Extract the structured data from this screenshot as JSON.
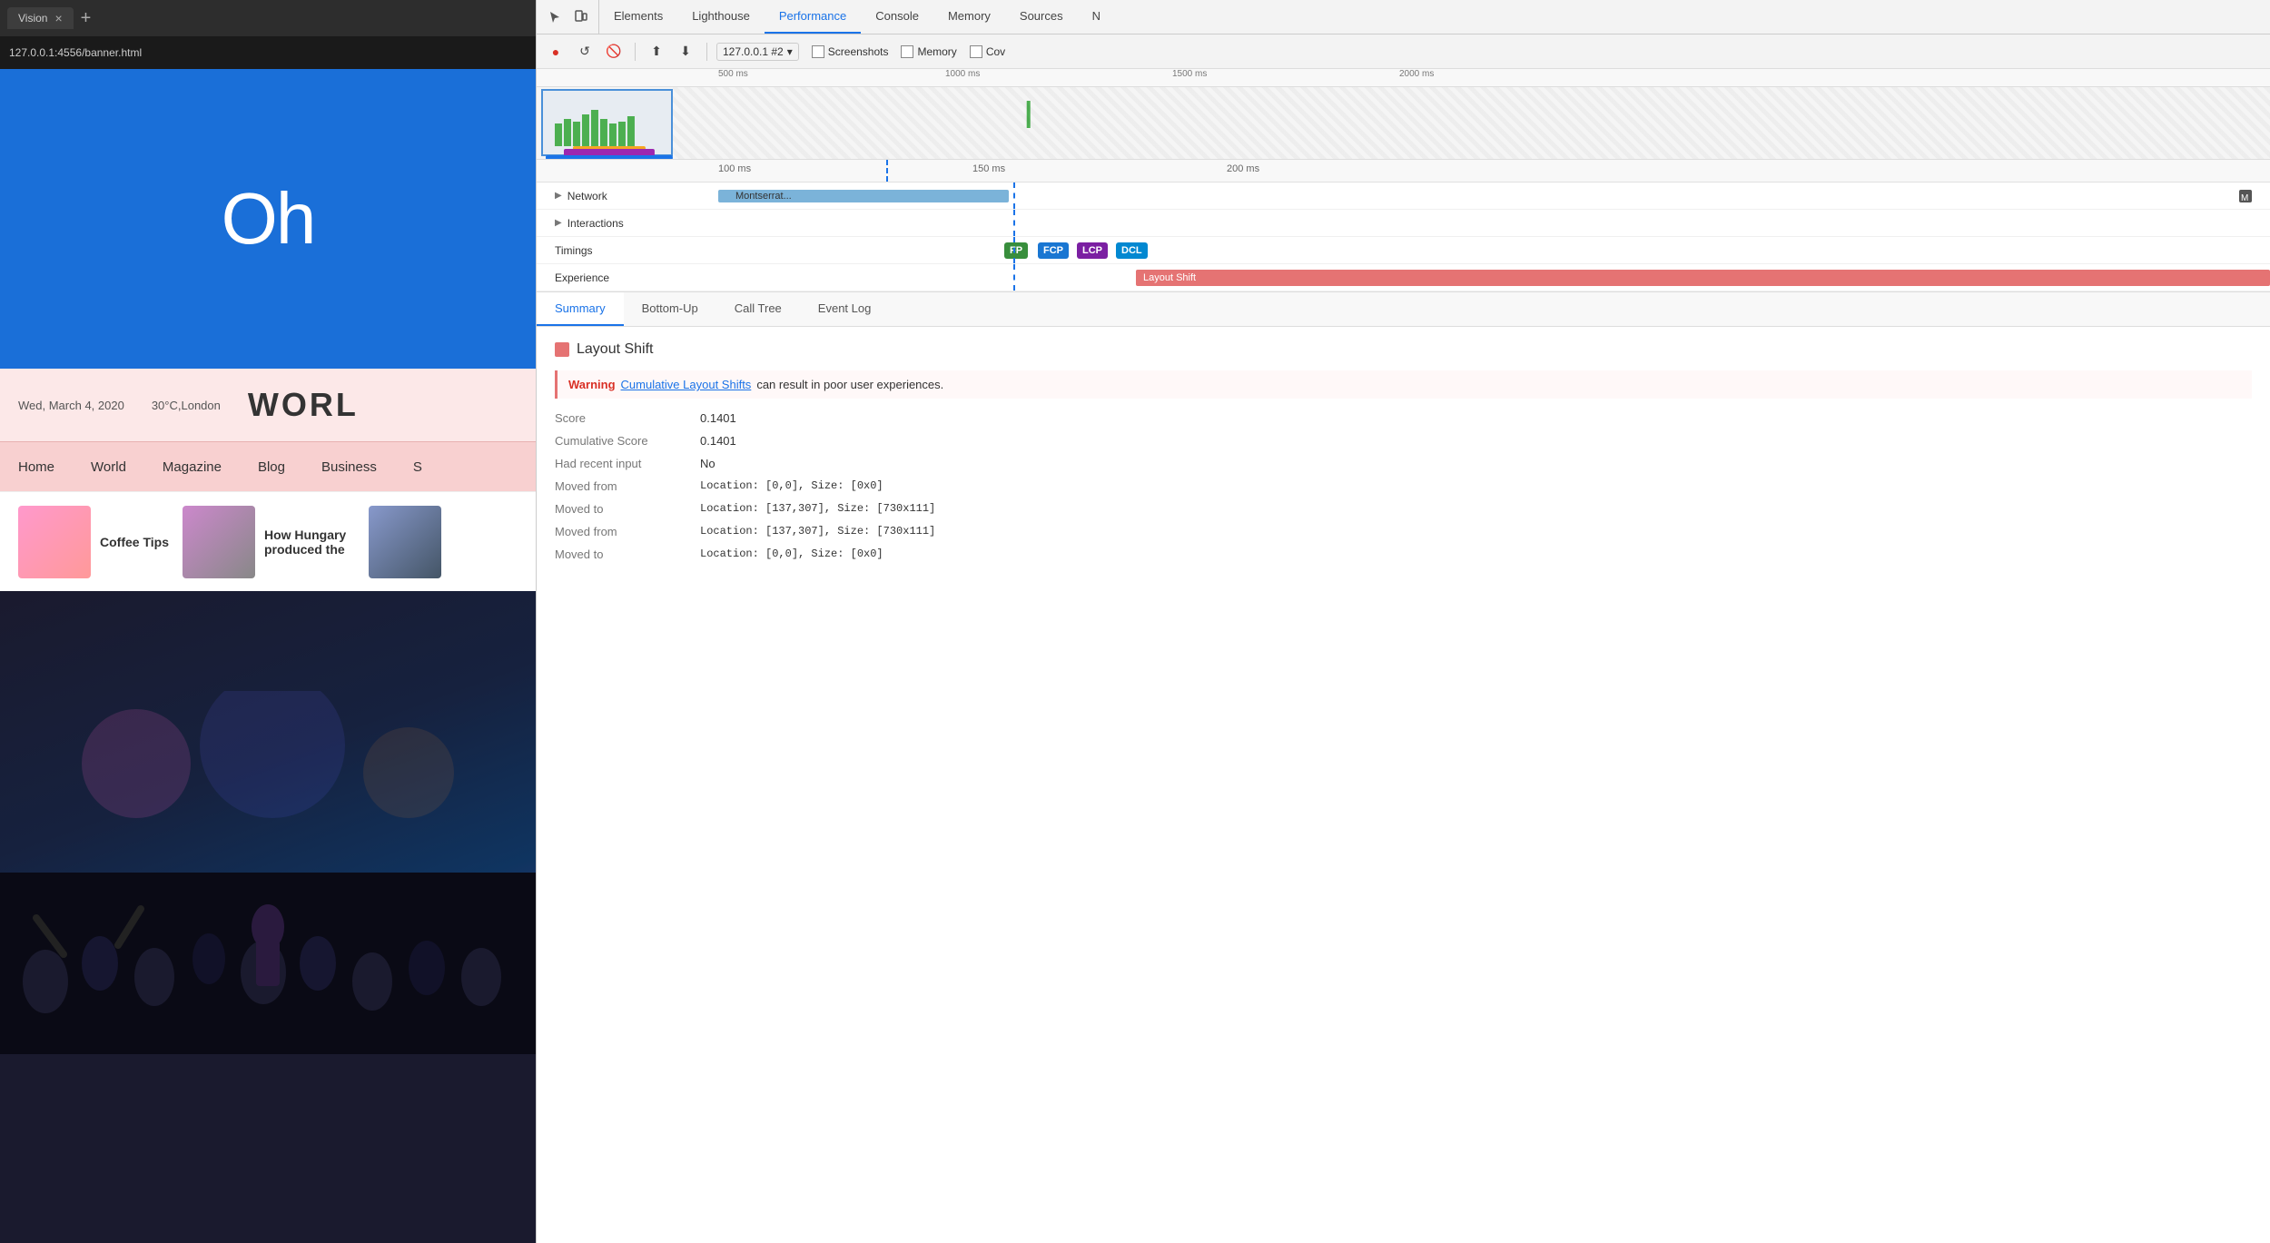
{
  "browser": {
    "tab_title": "Vision",
    "address": "127.0.0.1:4556/banner.html",
    "new_tab_label": "+"
  },
  "website": {
    "banner_text": "Oh",
    "date": "Wed, March 4, 2020",
    "weather": "30°C,London",
    "world_title": "WORL",
    "nav_items": [
      "Home",
      "World",
      "Magazine",
      "Blog",
      "Business",
      "S"
    ],
    "articles": [
      {
        "title": "Coffee Tips"
      },
      {
        "title": "How Hungary produced the"
      }
    ]
  },
  "devtools": {
    "tabs": [
      "Elements",
      "Lighthouse",
      "Performance",
      "Console",
      "Memory",
      "Sources",
      "N"
    ],
    "active_tab": "Performance",
    "controls": {
      "record_label": "●",
      "reload_label": "↺",
      "clear_label": "🚫",
      "upload_label": "⬆",
      "download_label": "⬇",
      "profile": "127.0.0.1 #2",
      "screenshots_label": "Screenshots",
      "memory_label": "Memory",
      "coverage_label": "Cov"
    },
    "timeline_ruler": {
      "marks": [
        "500 ms",
        "1000 ms",
        "1500 ms",
        "2000 ms"
      ]
    },
    "detail_ruler": {
      "marks": [
        "100 ms",
        "150 ms",
        "200 ms"
      ]
    },
    "rows": {
      "network_label": "Network",
      "network_item": "Montserrat...",
      "network_item2": "M",
      "interactions_label": "Interactions",
      "timings_label": "Timings",
      "timings_chips": [
        "FP",
        "FCP",
        "LCP",
        "DCL"
      ],
      "experience_label": "Experience",
      "layout_shift_chip": "Layout Shift"
    },
    "bottom_tabs": [
      "Summary",
      "Bottom-Up",
      "Call Tree",
      "Event Log"
    ],
    "active_bottom_tab": "Summary",
    "details": {
      "title": "Layout Shift",
      "warning_label": "Warning",
      "warning_link": "Cumulative Layout Shifts",
      "warning_text": "can result in poor user experiences.",
      "score_label": "Score",
      "score_value": "0.1401",
      "cumulative_score_label": "Cumulative Score",
      "cumulative_score_value": "0.1401",
      "recent_input_label": "Had recent input",
      "recent_input_value": "No",
      "moved_from_1_label": "Moved from",
      "moved_from_1_value": "Location: [0,0], Size: [0x0]",
      "moved_to_1_label": "Moved to",
      "moved_to_1_value": "Location: [137,307], Size: [730x111]",
      "moved_from_2_label": "Moved from",
      "moved_from_2_value": "Location: [137,307], Size: [730x111]",
      "moved_to_2_label": "Moved to",
      "moved_to_2_value": "Location: [0,0], Size: [0x0]"
    }
  }
}
